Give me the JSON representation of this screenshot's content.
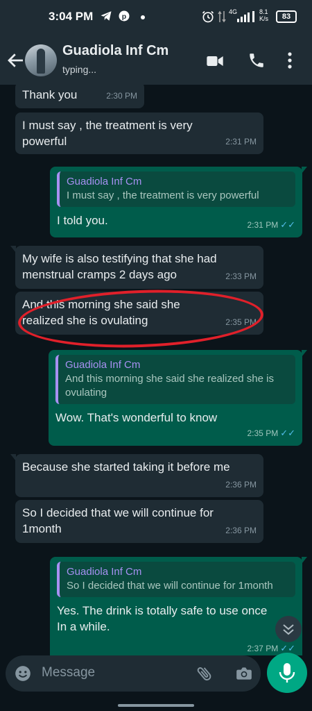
{
  "status_bar": {
    "time": "3:04 PM",
    "network": "4G",
    "speed": "8.1 K/s",
    "battery": "83",
    "icons": [
      "telegram-icon",
      "pinterest-icon",
      "dot-icon",
      "alarm-icon",
      "signal-icon",
      "battery-icon"
    ]
  },
  "header": {
    "contact_name": "Guadiola Inf Cm",
    "contact_status": "typing...",
    "icons": [
      "back-arrow-icon",
      "video-call-icon",
      "phone-icon",
      "more-options-icon"
    ]
  },
  "messages": [
    {
      "dir": "in",
      "text": "Thank you",
      "time": "2:30 PM"
    },
    {
      "dir": "in",
      "text": "I must say , the treatment is very powerful",
      "time": "2:31 PM"
    },
    {
      "dir": "out",
      "quote_name": "Guadiola Inf Cm",
      "quote_text": "I must say , the treatment is very powerful",
      "text": "I told you.",
      "time": "2:31 PM",
      "read": true
    },
    {
      "dir": "in",
      "text": "My wife is also testifying that she had menstrual cramps 2 days ago",
      "time": "2:33 PM"
    },
    {
      "dir": "in",
      "text": "And this morning she said she realized she is ovulating",
      "time": "2:35 PM",
      "highlighted": true
    },
    {
      "dir": "out",
      "quote_name": "Guadiola Inf Cm",
      "quote_text": "And this morning she said she realized she is ovulating",
      "text": "Wow. That's wonderful to know",
      "time": "2:35 PM",
      "read": true
    },
    {
      "dir": "in",
      "text": "Because she started taking it before me",
      "time": "2:36 PM"
    },
    {
      "dir": "in",
      "text": "So I decided that we will continue for 1month",
      "time": "2:36 PM"
    },
    {
      "dir": "out",
      "quote_name": "Guadiola Inf Cm",
      "quote_text": "So I decided that we will continue for 1month",
      "text": "Yes. The drink is totally safe to use once In a while.",
      "time": "2:37 PM",
      "read": true
    }
  ],
  "input_bar": {
    "placeholder": "Message",
    "icons": [
      "emoji-icon",
      "attach-icon",
      "camera-icon",
      "mic-icon"
    ]
  },
  "colors": {
    "background": "#0b141a",
    "incoming_bubble": "#1f2c34",
    "outgoing_bubble": "#005c4b",
    "accent": "#00a884",
    "quote_name": "#a791f2",
    "read_tick": "#53bdeb",
    "annotation": "#e0202a"
  }
}
